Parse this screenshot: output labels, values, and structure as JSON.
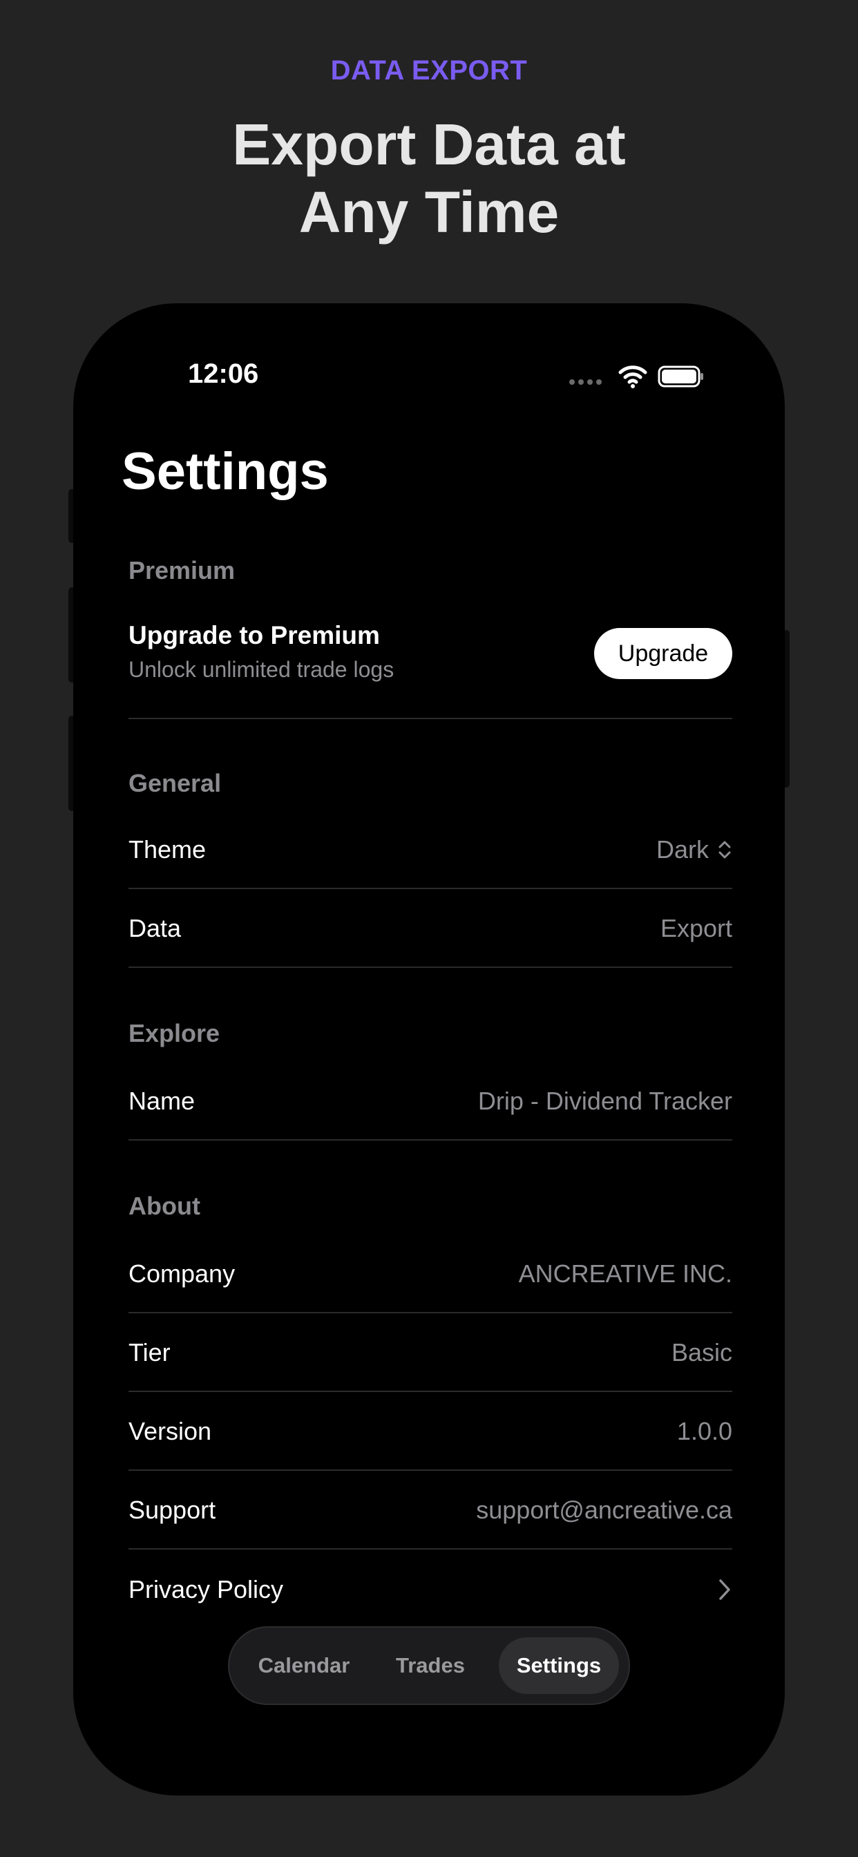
{
  "promo": {
    "eyebrow": "DATA EXPORT",
    "headline_line1": "Export Data at",
    "headline_line2": "Any Time",
    "accent_color": "#7a5cf0"
  },
  "status_bar": {
    "time": "12:06",
    "icons": [
      "signal-dots-icon",
      "wifi-icon",
      "battery-icon"
    ]
  },
  "page": {
    "title": "Settings"
  },
  "sections": {
    "premium": {
      "header": "Premium",
      "title": "Upgrade to Premium",
      "subtitle": "Unlock unlimited trade logs",
      "button_label": "Upgrade"
    },
    "general": {
      "header": "General",
      "theme": {
        "label": "Theme",
        "value": "Dark"
      },
      "data": {
        "label": "Data",
        "value": "Export"
      }
    },
    "explore": {
      "header": "Explore",
      "name": {
        "label": "Name",
        "value": "Drip - Dividend Tracker"
      }
    },
    "about": {
      "header": "About",
      "company": {
        "label": "Company",
        "value": "ANCREATIVE INC."
      },
      "tier": {
        "label": "Tier",
        "value": "Basic"
      },
      "version": {
        "label": "Version",
        "value": "1.0.0"
      },
      "support": {
        "label": "Support",
        "value": "support@ancreative.ca"
      },
      "privacy": {
        "label": "Privacy Policy"
      }
    }
  },
  "tabbar": {
    "tabs": [
      {
        "label": "Calendar"
      },
      {
        "label": "Trades"
      },
      {
        "label": "Settings"
      }
    ],
    "active": "Settings"
  }
}
